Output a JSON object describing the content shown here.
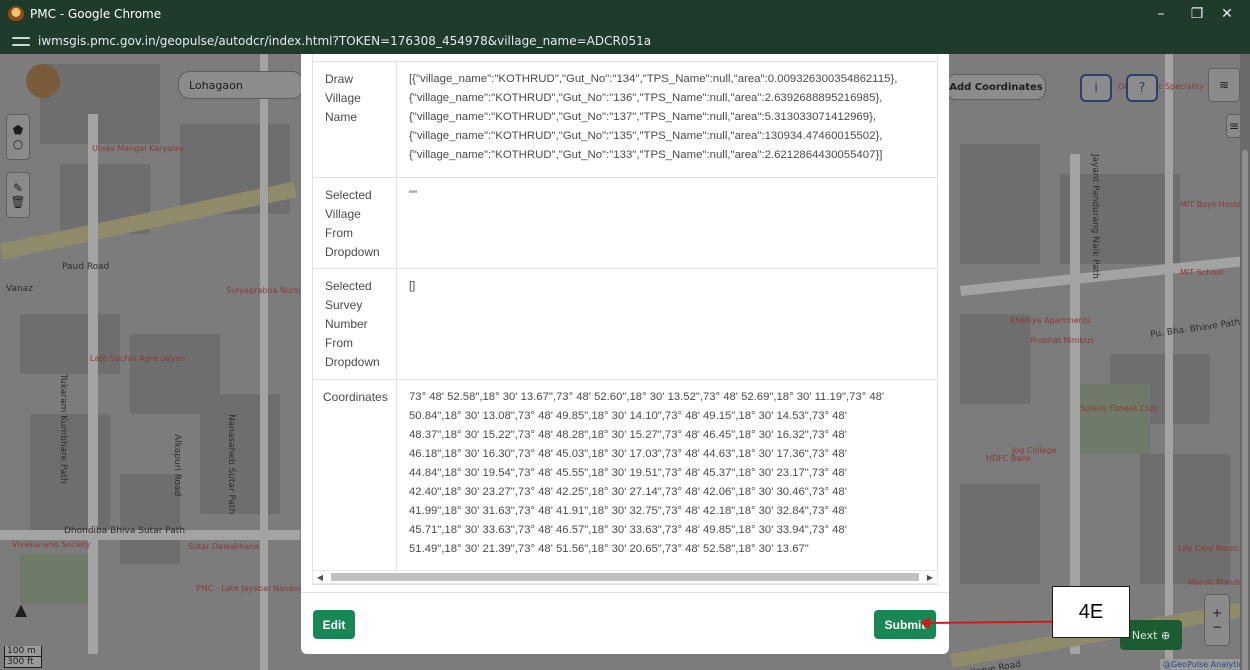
{
  "window": {
    "title": "PMC - Google Chrome",
    "url": "iwmsgis.pmc.gov.in/geopulse/autodcr/index.html?TOKEN=176308_454978&village_name=ADCR051a",
    "minimize": "–",
    "restore": "❐",
    "close": "✕"
  },
  "map": {
    "search_value": "Lohagaon",
    "add_coordinates_label": "Add Coordinates",
    "info_label": "i",
    "help_label": "?",
    "next_label": "Next ⊕",
    "zoom_in": "+",
    "zoom_out": "−",
    "scale_m": "100 m",
    "scale_ft": "300 ft",
    "attribution": "@GeoPulse Analytics",
    "labels": {
      "paud_road": "Paud Road",
      "pu_bha_bhave_path": "Pu. Bha. Bhave Path",
      "dhondiba": "Dhondiba Bhiva Sutar Path",
      "karve_road": "Karve Road",
      "jayant_pandurang": "Jayant Pandurang Naik Path",
      "tukaram": "Tukaram Kumbhare Path",
      "nanasaheb": "Nanasaheb Sutar Path",
      "alkapuri": "Alkapuri Road",
      "vanaz": "Vanaz",
      "suryaprabha": "Suryaprabha Nursing Home",
      "hdfc": "HDFC Bank",
      "khelliya": "Khelliya Apartments",
      "mit_school": "MIT School",
      "mit_boys": "MIT Boys Hostel",
      "jog_college": "Jog College",
      "vivekanand": "Vivekanand Society",
      "pmc_late": "PMC - Late Jayabai Nanasaheb Sutar Maternity Home",
      "sutar_dawakhana": "Sutar Dawakhana",
      "utsav": "Utsav Mangal Karyalay",
      "late_sachin": "Late Sachin Agre udyan",
      "orthopedic": "Orthopedic Speciality",
      "solaris": "Solaris Fitness Club",
      "life_care": "Life Care Medico",
      "maruti": "Maruti Mandir",
      "prabhat_nimbus": "Prabhat Nimbus"
    }
  },
  "table": {
    "rows": [
      {
        "label": "Draw\nVillage\nName",
        "value": "[{\"village_name\":\"KOTHRUD\",\"Gut_No\":\"134\",\"TPS_Name\":null,\"area\":0.009326300354862115},\n{\"village_name\":\"KOTHRUD\",\"Gut_No\":\"136\",\"TPS_Name\":null,\"area\":2.6392688895216985},\n{\"village_name\":\"KOTHRUD\",\"Gut_No\":\"137\",\"TPS_Name\":null,\"area\":5.313033071412969},\n{\"village_name\":\"KOTHRUD\",\"Gut_No\":\"135\",\"TPS_Name\":null,\"area\":130934.47460015502},\n{\"village_name\":\"KOTHRUD\",\"Gut_No\":\"133\",\"TPS_Name\":null,\"area\":2.6212864430055407}]"
      },
      {
        "label": "Selected\nVillage\nFrom\nDropdown",
        "value": "\"\""
      },
      {
        "label": "Selected\nSurvey\nNumber\nFrom\nDropdown",
        "value": "[]"
      },
      {
        "label": "Coordinates",
        "value": "73° 48' 52.58\",18° 30' 13.67\",73° 48' 52.60\",18° 30' 13.52\",73° 48' 52.69\",18° 30' 11.19\",73° 48'\n50.84\",18° 30' 13.08\",73° 48' 49.85\",18° 30' 14.10\",73° 48' 49.15\",18° 30' 14.53\",73° 48'\n48.37\",18° 30' 15.22\",73° 48' 48.28\",18° 30' 15.27\",73° 48' 46.45\",18° 30' 16.32\",73° 48'\n46.18\",18° 30' 16.30\",73° 48' 45.03\",18° 30' 17.03\",73° 48' 44.63\",18° 30' 17.36\",73° 48'\n44.84\",18° 30' 19.54\",73° 48' 45.55\",18° 30' 19.51\",73° 48' 45.37\",18° 30' 23.17\",73° 48'\n42.40\",18° 30' 23.27\",73° 48' 42.25\",18° 30' 27.14\",73° 48' 42.06\",18° 30' 30.46\",73° 48'\n41.99\",18° 30' 31.63\",73° 48' 41.91\",18° 30' 32.75\",73° 48' 42.18\",18° 30' 32.84\",73° 48'\n45.71\",18° 30' 33.63\",73° 48' 46.57\",18° 30' 33.63\",73° 48' 49.85\",18° 30' 33.94\",73° 48'\n51.49\",18° 30' 21.39\",73° 48' 51.56\",18° 30' 20.65\",73° 48' 52.58\",18° 30' 13.67\""
      }
    ]
  },
  "buttons": {
    "edit": "Edit",
    "submit": "Submit"
  },
  "annotation": {
    "label": "4E",
    "color": "#d01a1a"
  },
  "colors": {
    "button_green": "#198754",
    "title_bar": "#1f3b2c"
  }
}
